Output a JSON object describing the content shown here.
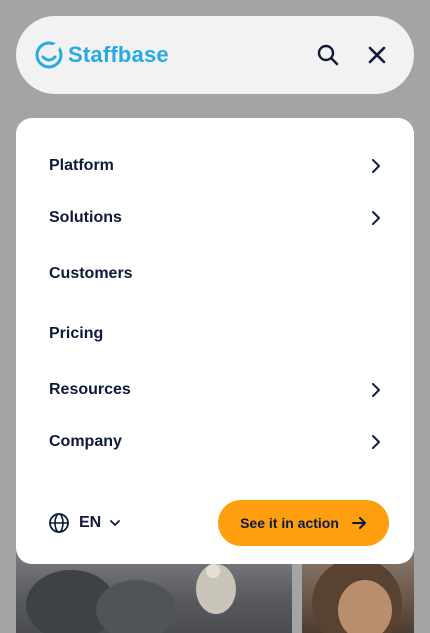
{
  "header": {
    "brand": "Staffbase",
    "brand_color": "#28a9e2",
    "search_icon": "search-icon",
    "close_icon": "close-icon"
  },
  "nav": {
    "items": [
      {
        "label": "Platform",
        "has_submenu": true
      },
      {
        "label": "Solutions",
        "has_submenu": true
      },
      {
        "label": "Customers",
        "has_submenu": false
      },
      {
        "label": "Pricing",
        "has_submenu": false
      },
      {
        "label": "Resources",
        "has_submenu": true
      },
      {
        "label": "Company",
        "has_submenu": true
      }
    ]
  },
  "language": {
    "code": "EN",
    "icon": "globe-icon"
  },
  "cta": {
    "label": "See it in action",
    "color": "#ff9e0f",
    "icon": "arrow-right-icon"
  },
  "colors": {
    "text": "#0d1a3b",
    "panel": "#ffffff",
    "backdrop": "#a4a4a4"
  }
}
